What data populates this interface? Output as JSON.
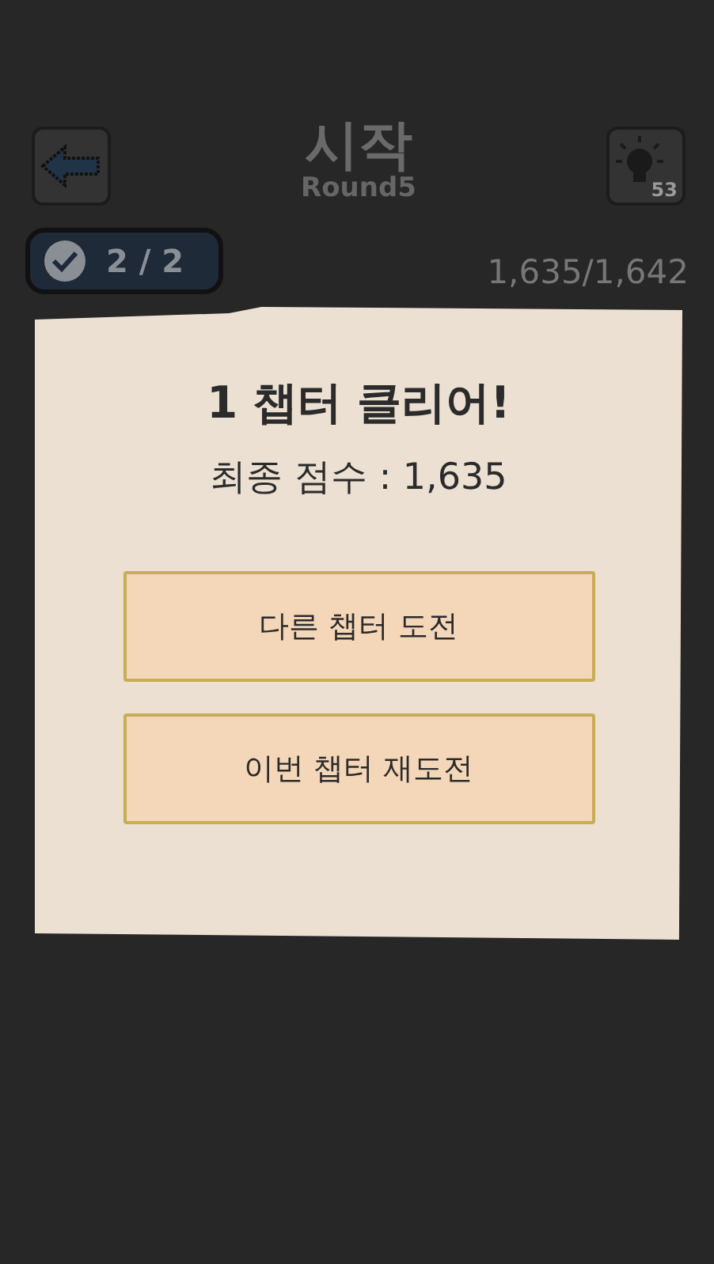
{
  "header": {
    "title": "시작",
    "subtitle": "Round5",
    "hint_count": "53"
  },
  "status": {
    "stage_count": "2 / 2",
    "score": "1,635/1,642"
  },
  "dialog": {
    "title": "1 챕터 클리어!",
    "final_score": "최종 점수 : 1,635",
    "buttons": [
      "다른 챕터 도전",
      "이번 챕터 재도전"
    ]
  }
}
